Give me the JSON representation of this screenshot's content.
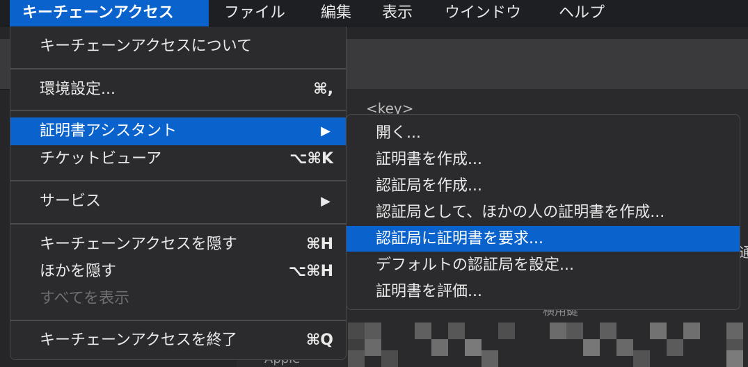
{
  "menubar": {
    "items": [
      {
        "label": "キーチェーンアクセス",
        "active": true
      },
      {
        "label": "ファイル"
      },
      {
        "label": "編集"
      },
      {
        "label": "表示"
      },
      {
        "label": "ウインドウ"
      },
      {
        "label": "ヘルプ"
      }
    ]
  },
  "main_menu": {
    "items": [
      {
        "label": "キーチェーンアクセスについて",
        "shortcut": ""
      },
      {
        "label": "環境設定...",
        "shortcut": "⌘,"
      },
      {
        "label": "証明書アシスタント",
        "has_submenu": true,
        "highlighted": true
      },
      {
        "label": "チケットビューア",
        "shortcut": "⌥⌘K"
      },
      {
        "label": "サービス",
        "has_submenu": true
      },
      {
        "label": "キーチェーンアクセスを隠す",
        "shortcut": "⌘H"
      },
      {
        "label": "ほかを隠す",
        "shortcut": "⌥⌘H"
      },
      {
        "label": "すべてを表示",
        "disabled": true
      },
      {
        "label": "キーチェーンアクセスを終了",
        "shortcut": "⌘Q"
      }
    ],
    "submenu_arrow": "▶"
  },
  "submenu": {
    "items": [
      {
        "label": "開く..."
      },
      {
        "label": "証明書を作成..."
      },
      {
        "label": "認証局を作成..."
      },
      {
        "label": "認証局として、ほかの人の証明書を作成..."
      },
      {
        "label": "認証局に証明書を要求...",
        "highlighted": true
      },
      {
        "label": "デフォルトの認証局を設定..."
      },
      {
        "label": "証明書を評価..."
      }
    ]
  },
  "background": {
    "header_text": "<key>",
    "cell_right": "通",
    "cell_mid": "横用鍵",
    "cell_bottom": "Apple"
  },
  "colors": {
    "accent": "#0a63cc",
    "menu_bg": "#2b2b2d",
    "menubar_bg": "#1e1f22"
  }
}
